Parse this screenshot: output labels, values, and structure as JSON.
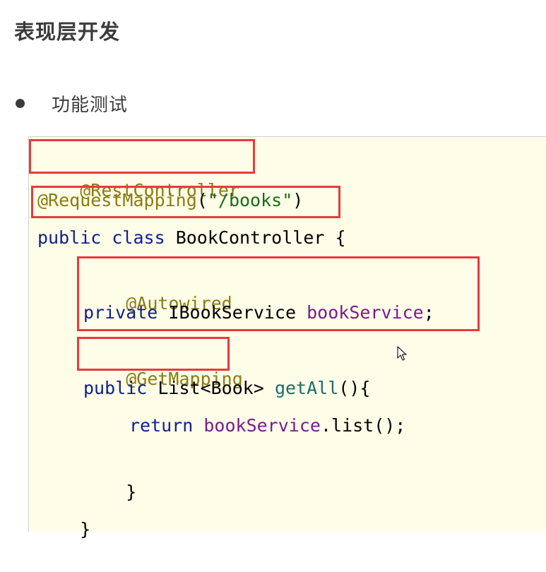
{
  "heading": {
    "title": "表现层开发"
  },
  "bullet": {
    "text": "功能测试"
  },
  "code": {
    "line1_annotation": "@RestController",
    "line2_annotation": "@RequestMapping",
    "line2_open": "(",
    "line2_string": "\"/books\"",
    "line2_close": ")",
    "line3_kw1": "public",
    "line3_kw2": "class",
    "line3_name": "BookController {",
    "line4_annotation": "@Autowired",
    "line5_kw": "private",
    "line5_type": "IBookService",
    "line5_field": "bookService",
    "line5_end": ";",
    "line6_annotation": "@GetMapping",
    "line7_kw": "public",
    "line7_type": "List<Book>",
    "line7_method": "getAll",
    "line7_end": "(){",
    "line8_kw": "return",
    "line8_field": "bookService",
    "line8_call": ".list();",
    "line9_brace": "}",
    "line10_brace": "}"
  },
  "colors": {
    "annotation": "#8b7b12",
    "keyword": "#0d1f8f",
    "string": "#1a6b1a",
    "field": "#7a1a8f",
    "method": "#1d6b6b",
    "highlight": "#e83a3a",
    "panel_background": "#fefde8"
  },
  "icons": {
    "pointer": "mouse-pointer-icon"
  }
}
